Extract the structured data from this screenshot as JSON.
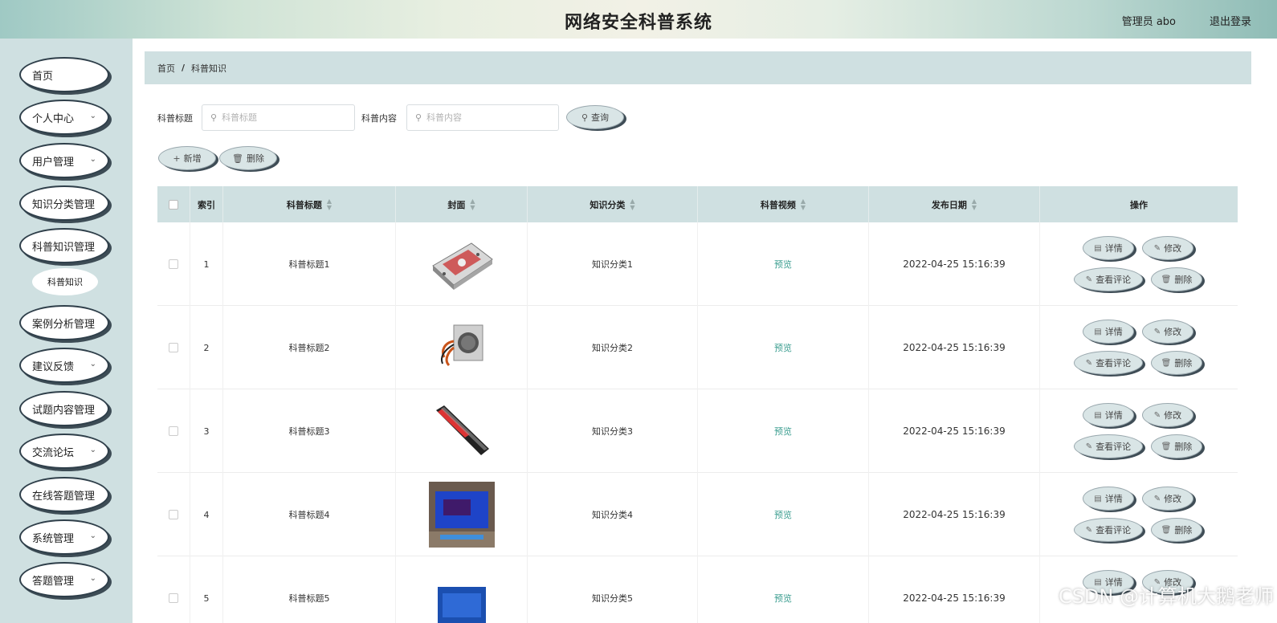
{
  "header": {
    "title": "网络安全科普系统",
    "user": "管理员 abo",
    "logout": "退出登录"
  },
  "sidebar": {
    "items": [
      {
        "label": "首页",
        "has_children": false
      },
      {
        "label": "个人中心",
        "has_children": true
      },
      {
        "label": "用户管理",
        "has_children": true
      },
      {
        "label": "知识分类管理",
        "has_children": false
      },
      {
        "label": "科普知识管理",
        "has_children": false
      },
      {
        "label": "案例分析管理",
        "has_children": false
      },
      {
        "label": "建议反馈",
        "has_children": true
      },
      {
        "label": "试题内容管理",
        "has_children": false
      },
      {
        "label": "交流论坛",
        "has_children": true
      },
      {
        "label": "在线答题管理",
        "has_children": false
      },
      {
        "label": "系统管理",
        "has_children": true
      },
      {
        "label": "答题管理",
        "has_children": true
      }
    ],
    "sub_item": "科普知识"
  },
  "breadcrumb": {
    "home": "首页",
    "separator": "/",
    "current": "科普知识"
  },
  "search": {
    "title_label": "科普标题",
    "title_placeholder": "科普标题",
    "content_label": "科普内容",
    "content_placeholder": "科普内容",
    "query_button": "查询"
  },
  "toolbar": {
    "add_button": "新增",
    "delete_button": "删除"
  },
  "table": {
    "columns": {
      "index": "索引",
      "title": "科普标题",
      "cover": "封面",
      "category": "知识分类",
      "video": "科普视频",
      "date": "发布日期",
      "ops": "操作"
    },
    "rows": [
      {
        "index": "1",
        "title": "科普标题1",
        "category": "知识分类1",
        "video": "预览",
        "date": "2022-04-25 15:16:39",
        "cover": "hard-drive"
      },
      {
        "index": "2",
        "title": "科普标题2",
        "category": "知识分类2",
        "video": "预览",
        "date": "2022-04-25 15:16:39",
        "cover": "power-supply"
      },
      {
        "index": "3",
        "title": "科普标题3",
        "category": "知识分类3",
        "video": "预览",
        "date": "2022-04-25 15:16:39",
        "cover": "memory-stick"
      },
      {
        "index": "4",
        "title": "科普标题4",
        "category": "知识分类4",
        "video": "预览",
        "date": "2022-04-25 15:16:39",
        "cover": "monitor"
      },
      {
        "index": "5",
        "title": "科普标题5",
        "category": "知识分类5",
        "video": "预览",
        "date": "2022-04-25 15:16:39",
        "cover": "cpu-box"
      }
    ],
    "row_actions": {
      "detail": "详情",
      "edit": "修改",
      "comments": "查看评论",
      "delete": "删除"
    }
  },
  "watermark": "CSDN @计算机大鹅老师",
  "colors": {
    "sidebar_bg": "#cfe0e1",
    "header_bar": "#cfe0e1",
    "link_green": "#3a9d8f",
    "button_bg": "#d9e5e6",
    "button_shadow": "#3f4d56"
  }
}
